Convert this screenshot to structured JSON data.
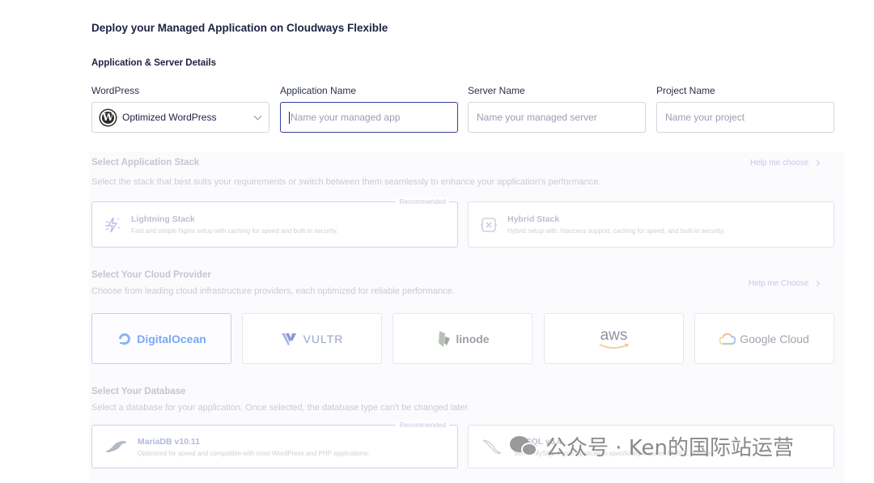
{
  "page": {
    "title": "Deploy your Managed Application on Cloudways Flexible",
    "section_title": "Application & Server Details"
  },
  "fields": {
    "app_type": {
      "label": "WordPress",
      "value": "Optimized WordPress"
    },
    "app_name": {
      "label": "Application Name",
      "placeholder": "Name your managed app"
    },
    "server_name": {
      "label": "Server Name",
      "placeholder": "Name your managed server"
    },
    "project_name": {
      "label": "Project Name",
      "placeholder": "Name your project"
    }
  },
  "stack": {
    "title": "Select Application Stack",
    "description": "Select the stack that best suits your requirements or switch between them seamlessly to enhance your application's performance.",
    "help": "Help me choose",
    "options": [
      {
        "name": "Lightning Stack",
        "sub": "Fast and simple Nginx setup with caching for speed and built-in security.",
        "badge": "Recommended",
        "icon": "lightning-icon"
      },
      {
        "name": "Hybrid Stack",
        "sub": "Hybrid setup with .htaccess support, caching for speed, and built-in security.",
        "icon": "hybrid-icon"
      }
    ]
  },
  "cloud": {
    "title": "Select Your Cloud Provider",
    "description": "Choose from leading cloud infrastructure providers, each optimized for reliable performance.",
    "help": "Help me Choose",
    "providers": [
      {
        "name": "DigitalOcean",
        "color": "#7aa7f5"
      },
      {
        "name": "VULTR",
        "color": "#9aa8d8"
      },
      {
        "name": "linode",
        "color": "#9aa39a"
      },
      {
        "name": "aws",
        "color": "#8a8f9c"
      },
      {
        "name": "Google Cloud",
        "color": "#a0a4ad"
      }
    ]
  },
  "database": {
    "title": "Select Your Database",
    "description": "Select a database for your application. Once selected, the database type can't be changed later.",
    "options": [
      {
        "name": "MariaDB v10.11",
        "sub": "Optimized for speed and compatible with most WordPress and PHP applications.",
        "badge": "Recommended"
      },
      {
        "name": "MySQL v8.4",
        "sub": "Select MySQL if your application specifically requires MySQL features."
      }
    ]
  },
  "watermark": {
    "text": "公众号 · Ken的国际站运营"
  }
}
